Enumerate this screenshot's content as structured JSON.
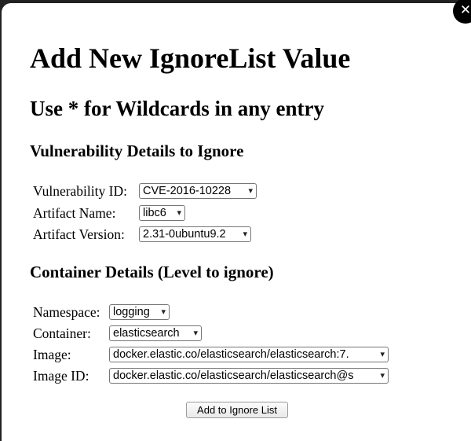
{
  "modal": {
    "close_glyph": "✕",
    "title": "Add New IgnoreList Value",
    "subtitle": "Use * for Wildcards in any entry"
  },
  "vulnerability_section": {
    "heading": "Vulnerability Details to Ignore",
    "fields": [
      {
        "label": "Vulnerability ID:",
        "value": "CVE-2016-10228"
      },
      {
        "label": "Artifact Name:",
        "value": "libc6"
      },
      {
        "label": "Artifact Version:",
        "value": "2.31-0ubuntu9.2"
      }
    ]
  },
  "container_section": {
    "heading": "Container Details (Level to ignore)",
    "fields": [
      {
        "label": "Namespace:",
        "value": "logging"
      },
      {
        "label": "Container:",
        "value": "elasticsearch"
      },
      {
        "label": "Image:",
        "value": "docker.elastic.co/elasticsearch/elasticsearch:7."
      },
      {
        "label": "Image ID:",
        "value": "docker.elastic.co/elasticsearch/elasticsearch@s"
      }
    ]
  },
  "actions": {
    "add_label": "Add to Ignore List"
  },
  "icons": {
    "close": "close-icon",
    "dropdown": "chevron-down-icon"
  }
}
